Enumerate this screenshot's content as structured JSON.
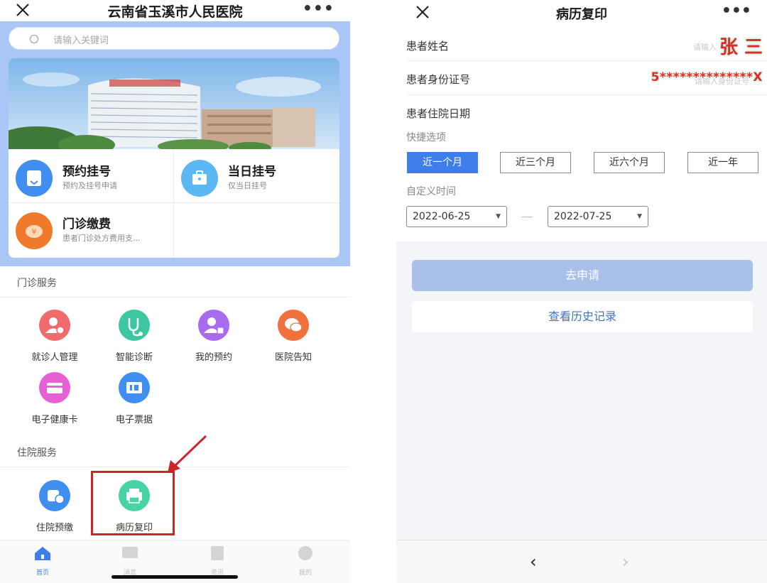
{
  "left": {
    "title": "云南省玉溪市人民医院",
    "search_placeholder": "请输入关键词",
    "services": [
      {
        "title": "预约挂号",
        "subtitle": "预约及挂号申请",
        "icon": "calendar-icon",
        "color": "#3f8ef0"
      },
      {
        "title": "当日挂号",
        "subtitle": "仅当日挂号",
        "icon": "briefcase-icon",
        "color": "#5cb8f2"
      },
      {
        "title": "门诊缴费",
        "subtitle": "患者门诊处方费用支...",
        "icon": "yen-coin-icon",
        "color": "#f07a2c"
      }
    ],
    "outpatient_section": "门诊服务",
    "outpatient_items": [
      {
        "label": "就诊人管理",
        "icon": "patient-manage-icon",
        "color": "#f06b6b"
      },
      {
        "label": "智能诊断",
        "icon": "stethoscope-icon",
        "color": "#3cc7a1"
      },
      {
        "label": "我的预约",
        "icon": "my-appointment-icon",
        "color": "#a86bf0"
      },
      {
        "label": "医院告知",
        "icon": "chat-bubble-icon",
        "color": "#f0713e"
      },
      {
        "label": "电子健康卡",
        "icon": "health-card-icon",
        "color": "#e860d6"
      },
      {
        "label": "电子票据",
        "icon": "receipt-icon",
        "color": "#3f8ef0"
      }
    ],
    "inpatient_section": "住院服务",
    "inpatient_items": [
      {
        "label": "住院预缴",
        "icon": "prepay-icon",
        "color": "#3f8ef0"
      },
      {
        "label": "病历复印",
        "icon": "printer-icon",
        "color": "#47d3a6"
      }
    ],
    "tabs": [
      "首页",
      "消息",
      "资讯",
      "我的"
    ],
    "active_tab": "首页"
  },
  "right": {
    "title": "病历复印",
    "patient_name_label": "患者姓名",
    "patient_name_value": "张 三",
    "patient_name_hint": "请输入",
    "patient_id_label": "患者身份证号",
    "patient_id_value": "5**************X",
    "patient_id_hint": "请输入身份证号",
    "admission_date_label": "患者住院日期",
    "quick_label": "快捷选项",
    "quick_options": [
      "近一个月",
      "近三个月",
      "近六个月",
      "近一年"
    ],
    "quick_selected": "近一个月",
    "custom_label": "自定义时间",
    "date_from": "2022-06-25",
    "date_to": "2022-07-25",
    "apply_button": "去申请",
    "history_button": "查看历史记录",
    "nav_back": "‹",
    "nav_forward": "›"
  },
  "colors": {
    "accent_blue": "#3d7eea",
    "header_blue": "#a9c6f7",
    "highlight_red": "#c9262b"
  }
}
